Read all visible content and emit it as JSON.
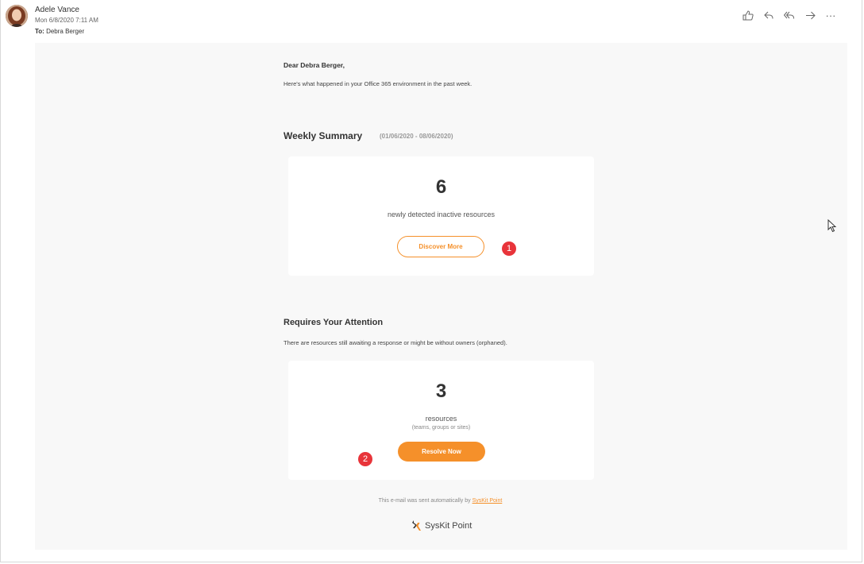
{
  "header": {
    "sender": "Adele Vance",
    "date": "Mon 6/8/2020 7:11 AM",
    "to_label": "To:",
    "to_value": "Debra Berger",
    "actions": [
      "like-icon",
      "reply-icon",
      "reply-all-icon",
      "forward-icon",
      "more-icon"
    ],
    "more_glyph": "···"
  },
  "body": {
    "greeting": "Dear Debra Berger,",
    "intro": "Here's what happened in your Office 365 environment in the past week.",
    "weekly": {
      "title": "Weekly Summary",
      "range": "(01/06/2020 - 08/06/2020)",
      "count": "6",
      "label": "newly detected inactive resources",
      "button": "Discover More"
    },
    "attention": {
      "title": "Requires Your Attention",
      "text": "There are resources still awaiting a response or might be without owners (orphaned).",
      "count": "3",
      "label": "resources",
      "sublabel": "(teams, groups or sites)",
      "button": "Resolve Now"
    },
    "footer": {
      "note": "This e-mail was sent automatically by",
      "link": "SysKit Point",
      "brand": "SysKit Point"
    }
  },
  "markers": [
    "1",
    "2"
  ],
  "colors": {
    "accent": "#f5902a",
    "marker": "#e8343a",
    "panel": "#f8f8f8"
  }
}
